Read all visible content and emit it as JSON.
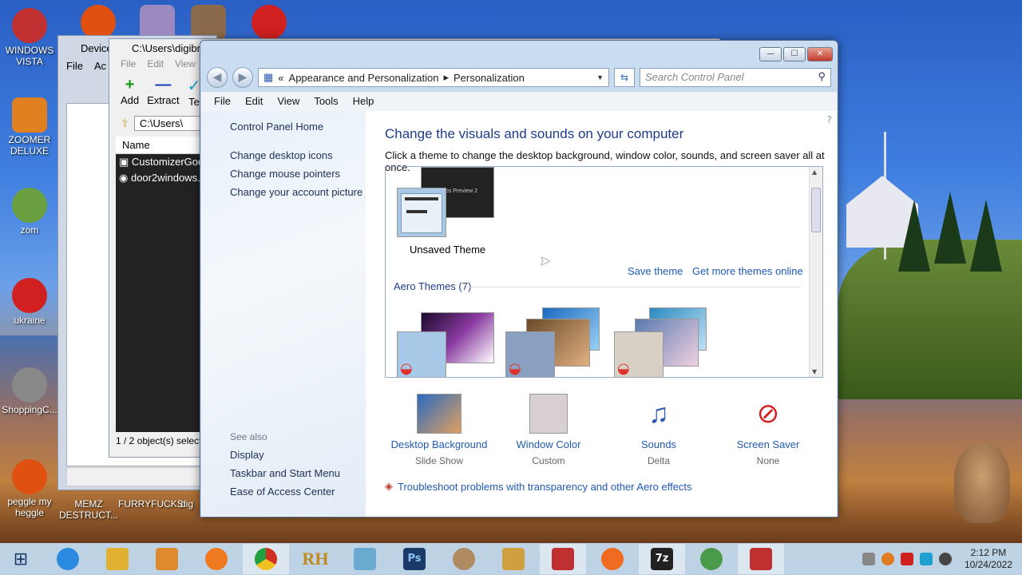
{
  "desktop": {
    "icons": [
      {
        "label": "WINDOWS VISTA",
        "color": "#c03030"
      },
      {
        "label": "ZOOMER DELUXE",
        "color": "#e08020"
      },
      {
        "label": "zom",
        "color": "#6aa040"
      },
      {
        "label": "ukraine",
        "color": "#d02020"
      },
      {
        "label": "ShoppingC...",
        "color": "#888888"
      },
      {
        "label": "peggle my heggle",
        "color": "#e05010"
      },
      {
        "label": "MEMZ DESTRUCT...",
        "color": "#3060c0"
      },
      {
        "label": "FURRYFUCKS",
        "color": "#7a5a3a"
      },
      {
        "label": "dig",
        "color": "#5a5a5a"
      }
    ]
  },
  "back_window_1": {
    "title": "Device",
    "menu": [
      "File",
      "Ac"
    ]
  },
  "back_window_2": {
    "title": "C:\\Users\\digibro",
    "menu": [
      "File",
      "Edit",
      "View"
    ],
    "toolbar": [
      "Add",
      "Extract",
      "Te"
    ],
    "path": "C:\\Users\\",
    "column": "Name",
    "files": [
      "CustomizerGod",
      "door2windows."
    ],
    "status": "1 / 2 object(s) select"
  },
  "window": {
    "breadcrumb": {
      "prefix": "«",
      "items": [
        "Appearance and Personalization",
        "Personalization"
      ],
      "separator": "▸"
    },
    "search_placeholder": "Search Control Panel",
    "menu": [
      "File",
      "Edit",
      "View",
      "Tools",
      "Help"
    ],
    "left_links": [
      "Control Panel Home",
      "Change desktop icons",
      "Change mouse pointers",
      "Change your account picture"
    ],
    "see_also_label": "See also",
    "see_also_links": [
      "Display",
      "Taskbar and Start Menu",
      "Ease of Access Center"
    ],
    "heading": "Change the visuals and sounds on your computer",
    "subtext": "Click a theme to change the desktop background, window color, sounds, and screen saver all at once.",
    "unsaved_theme": {
      "label": "Unsaved Theme",
      "preview_text": "ros Preview 2"
    },
    "save_theme": "Save theme",
    "get_more": "Get more themes online",
    "aero_section": "Aero Themes (7)",
    "bottom_items": [
      {
        "title": "Desktop Background",
        "sub": "Slide Show"
      },
      {
        "title": "Window Color",
        "sub": "Custom"
      },
      {
        "title": "Sounds",
        "sub": "Delta"
      },
      {
        "title": "Screen Saver",
        "sub": "None"
      }
    ],
    "troubleshoot": "Troubleshoot problems with transparency and other Aero effects"
  },
  "taskbar": {
    "items": [
      "start",
      "internet-explorer",
      "file-explorer",
      "media-player",
      "app",
      "chrome",
      "rh",
      "photo-viewer",
      "photoshop",
      "hamster",
      "app2",
      "toolbox",
      "firefox",
      "7zip",
      "dial",
      "toolbox2"
    ],
    "clock_time": "2:12 PM",
    "clock_date": "10/24/2022"
  }
}
